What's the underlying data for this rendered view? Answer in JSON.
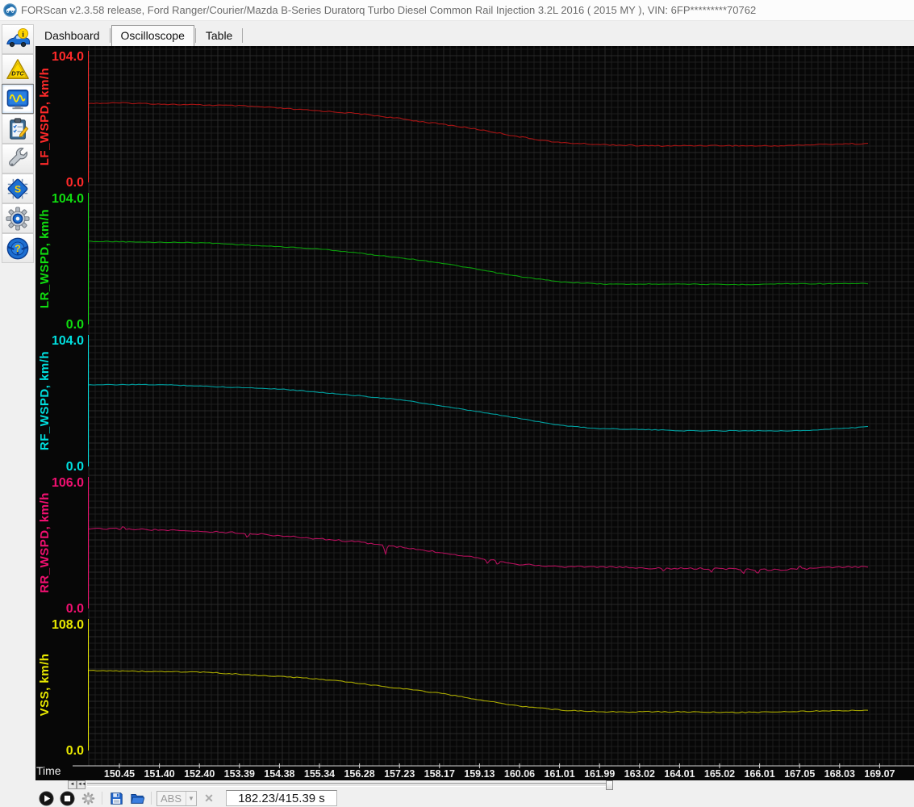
{
  "window": {
    "title": "FORScan v2.3.58 release, Ford Ranger/Courier/Mazda B-Series Duratorq Turbo Diesel Common Rail Injection 3.2L 2016 ( 2015 MY ), VIN: 6FP*********70762"
  },
  "tabs": [
    {
      "label": "Dashboard",
      "selected": false
    },
    {
      "label": "Oscilloscope",
      "selected": true
    },
    {
      "label": "Table",
      "selected": false
    }
  ],
  "sidebar": {
    "items": [
      {
        "name": "vehicle-info"
      },
      {
        "name": "dtc"
      },
      {
        "name": "oscilloscope",
        "selected": true
      },
      {
        "name": "tests"
      },
      {
        "name": "service"
      },
      {
        "name": "configuration"
      },
      {
        "name": "settings"
      },
      {
        "name": "help"
      }
    ]
  },
  "scrollbar": {
    "left_arrow": "◄",
    "fast_left_arrow": "◄◄"
  },
  "toolbar": {
    "module_select_value": "ABS",
    "dropdown_arrow": "▼",
    "clear_glyph": "✕",
    "position_label": "182.23/415.39 s"
  },
  "chart_data": {
    "type": "line",
    "title": "",
    "xlabel": "Time",
    "grid": true,
    "x_tick_labels": [
      "150.45",
      "151.40",
      "152.40",
      "153.39",
      "154.38",
      "155.34",
      "156.28",
      "157.23",
      "158.17",
      "159.13",
      "160.06",
      "161.01",
      "161.99",
      "163.02",
      "164.01",
      "165.02",
      "166.01",
      "167.05",
      "168.03",
      "169.07"
    ],
    "x_unit": "s",
    "series": [
      {
        "name": "LF_WSPD, km/h",
        "label_color": "#ff2a2a",
        "trace_color": "#a81414",
        "y_max": 104.0,
        "y_min": 0.0,
        "noise": 0.9,
        "values": [
          62.5,
          62.1,
          61.4,
          60.3,
          58.8,
          56.7,
          54.0,
          50.6,
          46.4,
          41.5,
          36.2,
          31.5,
          29.7,
          29.2,
          29.0,
          28.9,
          29.0,
          29.4,
          30.2,
          30.9
        ],
        "spikes": []
      },
      {
        "name": "LR_WSPD, km/h",
        "label_color": "#10dd10",
        "trace_color": "#0a9e0a",
        "y_max": 104.0,
        "y_min": 0.0,
        "noise": 0.6,
        "values": [
          65.5,
          65.1,
          64.4,
          63.2,
          61.6,
          59.4,
          56.5,
          52.9,
          48.5,
          43.4,
          37.9,
          33.4,
          32.2,
          31.9,
          31.8,
          31.7,
          31.8,
          32.0,
          32.3,
          32.6
        ],
        "spikes": []
      },
      {
        "name": "RF_WSPD, km/h",
        "label_color": "#00dfdf",
        "trace_color": "#009f9f",
        "y_max": 104.0,
        "y_min": 0.0,
        "noise": 0.6,
        "values": [
          64.8,
          64.4,
          63.7,
          62.6,
          61.0,
          58.8,
          56.0,
          52.5,
          48.2,
          43.2,
          37.7,
          32.8,
          30.0,
          29.0,
          28.5,
          28.2,
          28.0,
          28.4,
          30.0,
          31.5
        ],
        "spikes": []
      },
      {
        "name": "RR_WSPD, km/h",
        "label_color": "#f01070",
        "trace_color": "#b50f5c",
        "y_max": 106.0,
        "y_min": 0.0,
        "noise": 1.3,
        "values": [
          64.0,
          63.3,
          62.3,
          60.8,
          58.8,
          56.3,
          53.2,
          49.6,
          45.4,
          40.6,
          35.8,
          33.8,
          33.3,
          32.8,
          32.2,
          31.8,
          31.4,
          31.8,
          33.0,
          34.2
        ],
        "spikes": [
          {
            "i": 0.1,
            "dv": 1.8
          },
          {
            "i": 3.2,
            "dv": -4.0
          },
          {
            "i": 6.65,
            "dv": -8.0
          },
          {
            "i": 9.2,
            "dv": -3.5
          },
          {
            "i": 9.45,
            "dv": -3.5
          },
          {
            "i": 13.6,
            "dv": -2.5
          },
          {
            "i": 14.8,
            "dv": -3.0
          },
          {
            "i": 15.6,
            "dv": -3.5
          },
          {
            "i": 15.95,
            "dv": -3.0
          },
          {
            "i": 17.0,
            "dv": 2.5
          }
        ]
      },
      {
        "name": "VSS, km/h",
        "label_color": "#e8e800",
        "trace_color": "#a9a900",
        "y_max": 108.0,
        "y_min": 0.0,
        "noise": 0.8,
        "values": [
          65.5,
          65.0,
          64.1,
          62.8,
          60.9,
          58.4,
          55.2,
          51.3,
          46.8,
          41.8,
          36.6,
          33.0,
          32.1,
          31.8,
          31.6,
          31.5,
          31.6,
          31.9,
          32.8,
          33.6
        ],
        "spikes": []
      }
    ]
  }
}
